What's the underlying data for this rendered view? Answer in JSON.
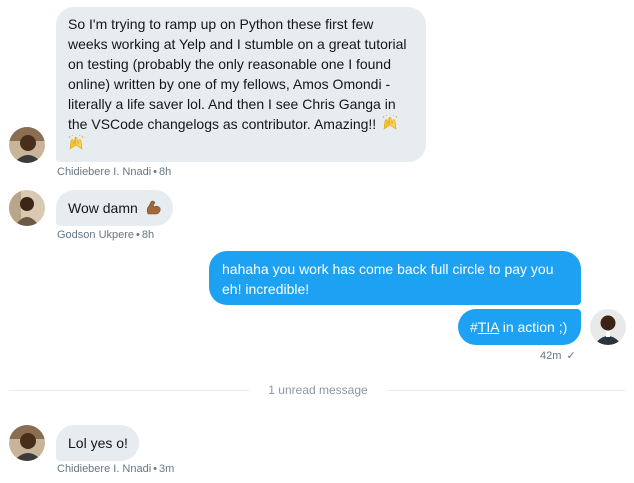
{
  "messages": [
    {
      "direction": "incoming",
      "text": "So I'm trying to ramp up on Python these first few weeks working at Yelp and I stumble on a great tutorial on testing (probably the only reasonable one I found online) written by one of my fellows, Amos Omondi - literally a life saver lol. And then I see Chris Ganga in the VSCode changelogs as contributor. Amazing!!",
      "lines": [
        "So I'm trying to ramp up on Python these first few",
        "weeks working at Yelp and I stumble on a great tutorial",
        "on testing (probably the only reasonable one I found",
        "online) written by one of my fellows, Amos Omondi -",
        "literally a life saver lol. And then I see Chris Ganga in",
        "the VSCode changelogs as contributor. Amazing!!"
      ],
      "emoji": "raising-hands",
      "sender": "Chidiebere I. Nnadi",
      "time": "8h"
    },
    {
      "direction": "incoming",
      "text": "Wow damn",
      "emoji": "flexed-biceps",
      "sender": "Godson Ukpere",
      "time": "8h"
    },
    {
      "direction": "outgoing",
      "lines": [
        "hahaha you work has come back full circle to pay you",
        "eh! incredible!"
      ]
    },
    {
      "direction": "outgoing",
      "hashtag_symbol": "#",
      "hashtag": "TIA",
      "text_after": " in action ;)",
      "time": "42m",
      "status": "✓"
    },
    {
      "direction": "incoming",
      "text": "Lol yes o!",
      "sender": "Chidiebere I. Nnadi",
      "time": "3m"
    }
  ],
  "unread_divider": "1 unread message",
  "separator": "•",
  "colors": {
    "incoming_bubble": "#e6ecf0",
    "outgoing_bubble": "#1da1f2",
    "meta_text": "#657786"
  }
}
